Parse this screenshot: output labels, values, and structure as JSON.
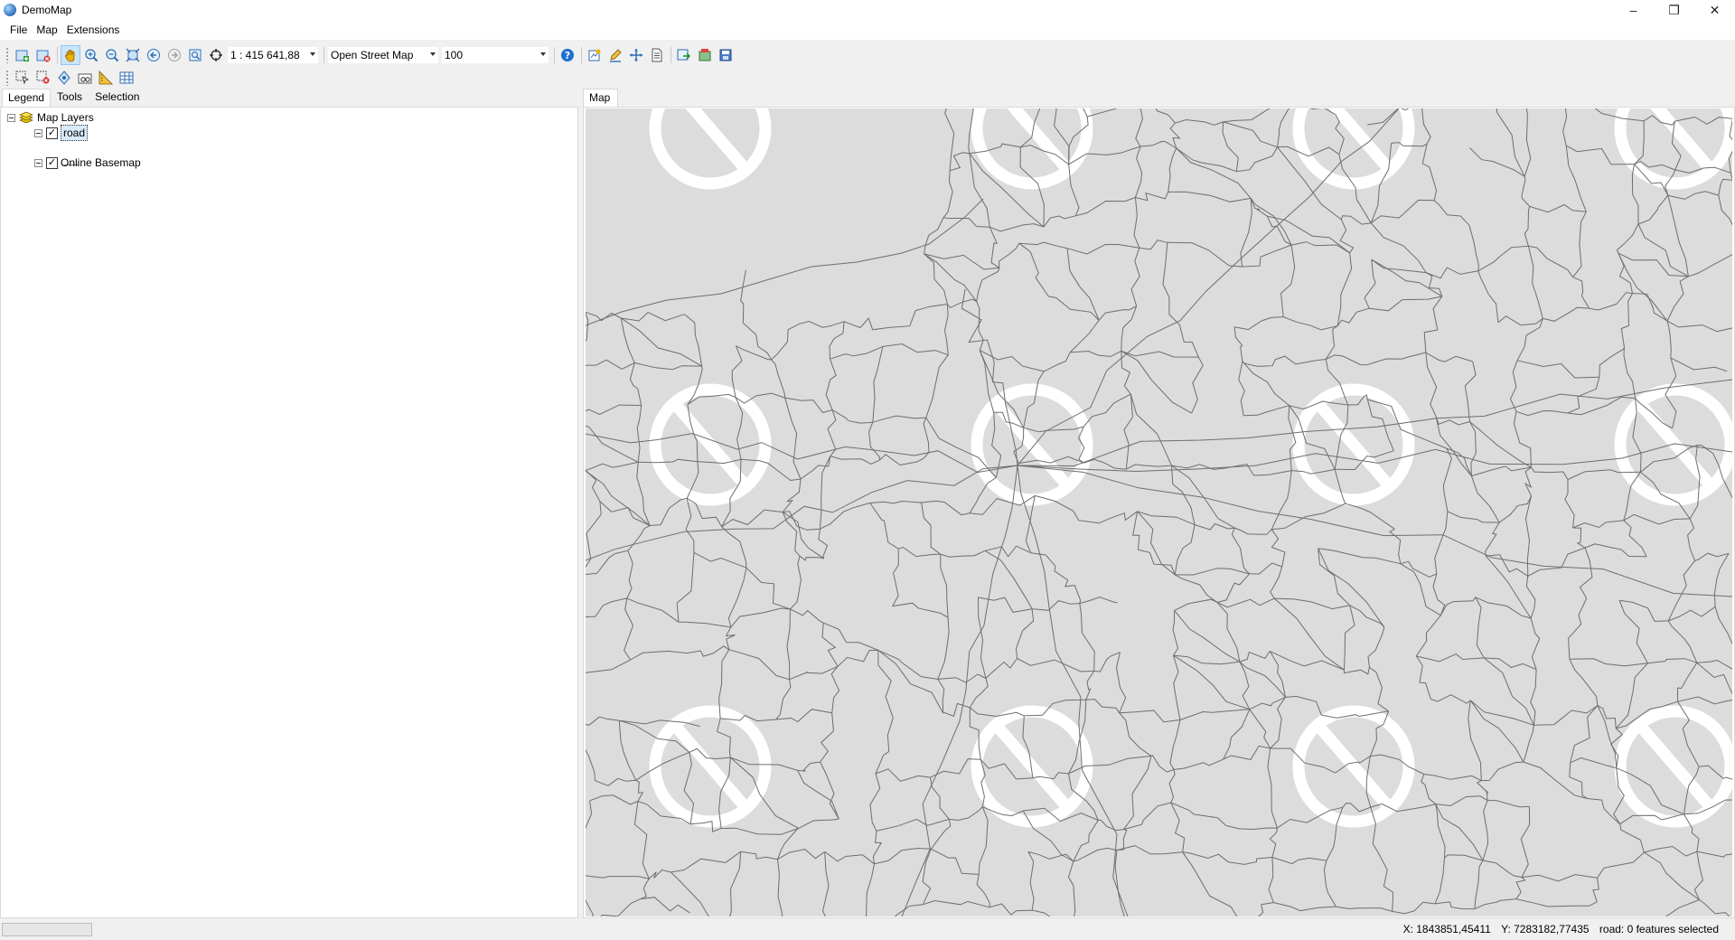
{
  "window": {
    "title": "DemoMap"
  },
  "menu": {
    "file": "File",
    "map": "Map",
    "extensions": "Extensions"
  },
  "toolbar": {
    "scale": "1 : 415 641,88",
    "basemap": "Open Street Map",
    "opacity": "100"
  },
  "left_tabs": {
    "legend": "Legend",
    "tools": "Tools",
    "selection": "Selection"
  },
  "legend": {
    "root": "Map Layers",
    "layers": [
      {
        "name": "road",
        "checked": true
      },
      {
        "name": "Online Basemap",
        "checked": true
      }
    ]
  },
  "map_tab": "Map",
  "status": {
    "x": "X: 1843851,45411",
    "y": "Y: 7283182,77435",
    "selection": "road: 0 features selected"
  },
  "colors": {
    "map_bg": "#dcdcdc",
    "road": "#6e6e6e",
    "tile_error": "#ffffff",
    "accent": "#0078d7"
  }
}
